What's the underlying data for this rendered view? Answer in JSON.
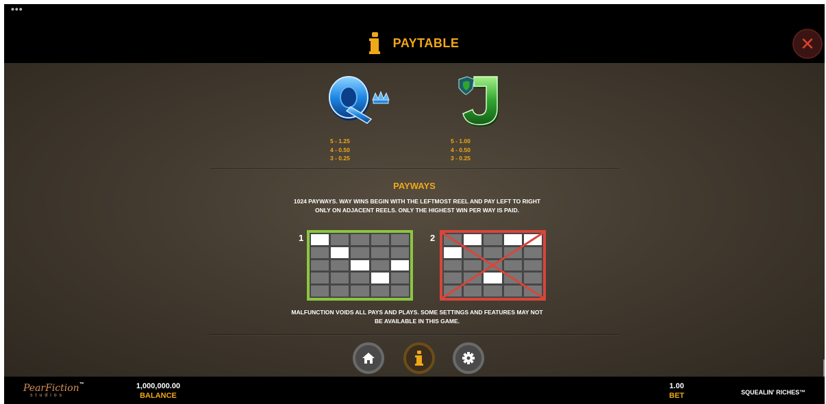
{
  "header": {
    "menu_icon": "ellipsis-icon",
    "title": "PAYTABLE",
    "title_icon": "info-icon",
    "close_icon": "close-icon"
  },
  "symbols": [
    {
      "name": "Q",
      "icon": "queen-letter-icon",
      "pays": [
        "5 - 1.25",
        "4 - 0.50",
        "3 - 0.25"
      ]
    },
    {
      "name": "J",
      "icon": "jack-letter-icon",
      "pays": [
        "5 - 1.00",
        "4 - 0.50",
        "3 - 0.25"
      ]
    }
  ],
  "payways": {
    "title": "PAYWAYS",
    "description": "1024 PAYWAYS. WAY WINS BEGIN WITH THE LEFTMOST REEL AND PAY LEFT TO RIGHT ONLY ON ADJACENT REELS. ONLY THE HIGHEST WIN PER WAY IS PAID.",
    "examples": [
      {
        "label": "1",
        "valid": true,
        "highlight_rows_by_reel": [
          0,
          1,
          2,
          3,
          2
        ]
      },
      {
        "label": "2",
        "valid": false,
        "highlight_rows_by_reel": [
          1,
          0,
          3,
          0,
          0
        ]
      }
    ],
    "disclaimer": "MALFUNCTION VOIDS ALL PAYS AND PLAYS. SOME SETTINGS AND FEATURES MAY NOT BE AVAILABLE IN THIS GAME."
  },
  "nav": {
    "home_icon": "home-icon",
    "info_icon": "info-icon",
    "settings_icon": "gear-icon"
  },
  "footer": {
    "brand": "PearFiction",
    "brand_tm": "™",
    "brand_sub": "studios",
    "balance_value": "1,000,000.00",
    "balance_label": "BALANCE",
    "bet_value": "1.00",
    "bet_label": "BET",
    "game_name": "SQUEALIN' RICHES™"
  },
  "colors": {
    "accent": "#f0a818",
    "valid_frame": "#8cc63f",
    "invalid_frame": "#d9453a",
    "close": "#d8432e"
  }
}
